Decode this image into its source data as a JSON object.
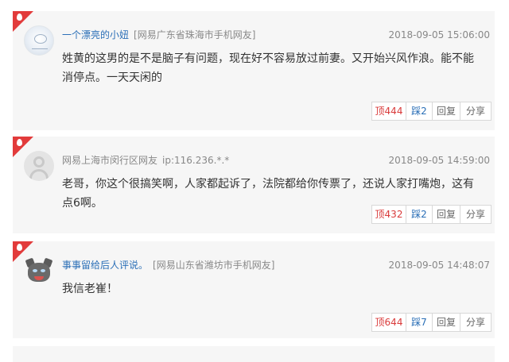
{
  "comments": [
    {
      "user": "一个漂亮的小妞",
      "location": "[网易广东省珠海市手机网友]",
      "time": "2018-09-05 15:06:00",
      "content": "姓黄的这男的是不是脑子有问题，现在好不容易放过前妻。又开始兴风作浪。能不能消停点。一天天闲的",
      "up": "顶444",
      "down": "踩2",
      "reply": "回复",
      "share": "分享"
    },
    {
      "user": "网易上海市闵行区网友",
      "location": "ip:116.236.*.*",
      "time": "2018-09-05 14:59:00",
      "content": "老哥，你这个很搞笑啊，人家都起诉了，法院都给你传票了，还说人家打嘴炮，这有点6啊。",
      "up": "顶432",
      "down": "踩2",
      "reply": "回复",
      "share": "分享"
    },
    {
      "user": "事事留给后人评说。",
      "location": "[网易山东省潍坊市手机网友]",
      "time": "2018-09-05 14:48:07",
      "content": "我信老崔！",
      "up": "顶644",
      "down": "踩7",
      "reply": "回复",
      "share": "分享"
    }
  ],
  "colors": {
    "card_bg": "#f6f6f6",
    "accent_red": "#e23b3b",
    "link_blue": "#2b6fb7"
  },
  "icons": [
    "hot-corner-icon",
    "avatar-sketch-icon",
    "avatar-default-user-icon",
    "avatar-cartoon-icon"
  ]
}
